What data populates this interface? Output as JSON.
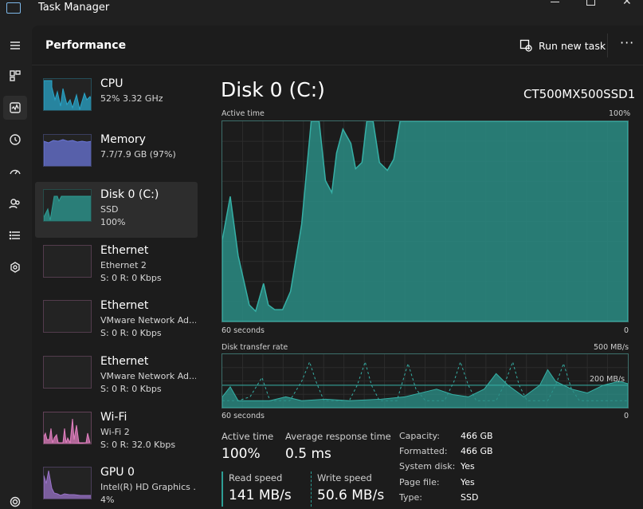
{
  "app": {
    "title": "Task Manager"
  },
  "header": {
    "title": "Performance",
    "run_task_label": "Run new task",
    "more_label": "···"
  },
  "devices": [
    {
      "name": "CPU",
      "sub1": "52%  3.32 GHz",
      "sub2": "",
      "color": "#2aa6c9"
    },
    {
      "name": "Memory",
      "sub1": "7.7/7.9 GB (97%)",
      "sub2": "",
      "color": "#6a76d8"
    },
    {
      "name": "Disk 0 (C:)",
      "sub1": "SSD",
      "sub2": "100%",
      "color": "#2e9e95"
    },
    {
      "name": "Ethernet",
      "sub1": "Ethernet 2",
      "sub2": "S: 0 R: 0 Kbps",
      "color": "#b56fa3"
    },
    {
      "name": "Ethernet",
      "sub1": "VMware Network Ad...",
      "sub2": "S: 0 R: 0 Kbps",
      "color": "#b56fa3"
    },
    {
      "name": "Ethernet",
      "sub1": "VMware Network Ad...",
      "sub2": "S: 0 R: 0 Kbps",
      "color": "#b56fa3"
    },
    {
      "name": "Wi-Fi",
      "sub1": "Wi-Fi 2",
      "sub2": "S: 0 R: 32.0 Kbps",
      "color": "#e27fc0"
    },
    {
      "name": "GPU 0",
      "sub1": "Intel(R) HD Graphics ...",
      "sub2": "4%",
      "color": "#9a73c8"
    }
  ],
  "detail": {
    "title": "Disk 0 (C:)",
    "model": "CT500MX500SSD1",
    "chart1": {
      "label": "Active time",
      "max_label": "100%",
      "xlabel": "60 seconds",
      "min_label": "0"
    },
    "chart2": {
      "label": "Disk transfer rate",
      "max_label": "500 MB/s",
      "mid_label": "200 MB/s",
      "xlabel": "60 seconds",
      "min_label": "0"
    },
    "stats": {
      "active_time_label": "Active time",
      "active_time_value": "100%",
      "avg_response_label": "Average response time",
      "avg_response_value": "0.5 ms",
      "read_label": "Read speed",
      "read_value": "141 MB/s",
      "write_label": "Write speed",
      "write_value": "50.6 MB/s"
    },
    "properties": [
      {
        "key": "Capacity:",
        "value": "466 GB"
      },
      {
        "key": "Formatted:",
        "value": "466 GB"
      },
      {
        "key": "System disk:",
        "value": "Yes"
      },
      {
        "key": "Page file:",
        "value": "Yes"
      },
      {
        "key": "Type:",
        "value": "SSD"
      }
    ]
  },
  "colors": {
    "accent": "#2e9e95",
    "accent_fill": "#2a8c84",
    "background": "#1c1c1c"
  }
}
